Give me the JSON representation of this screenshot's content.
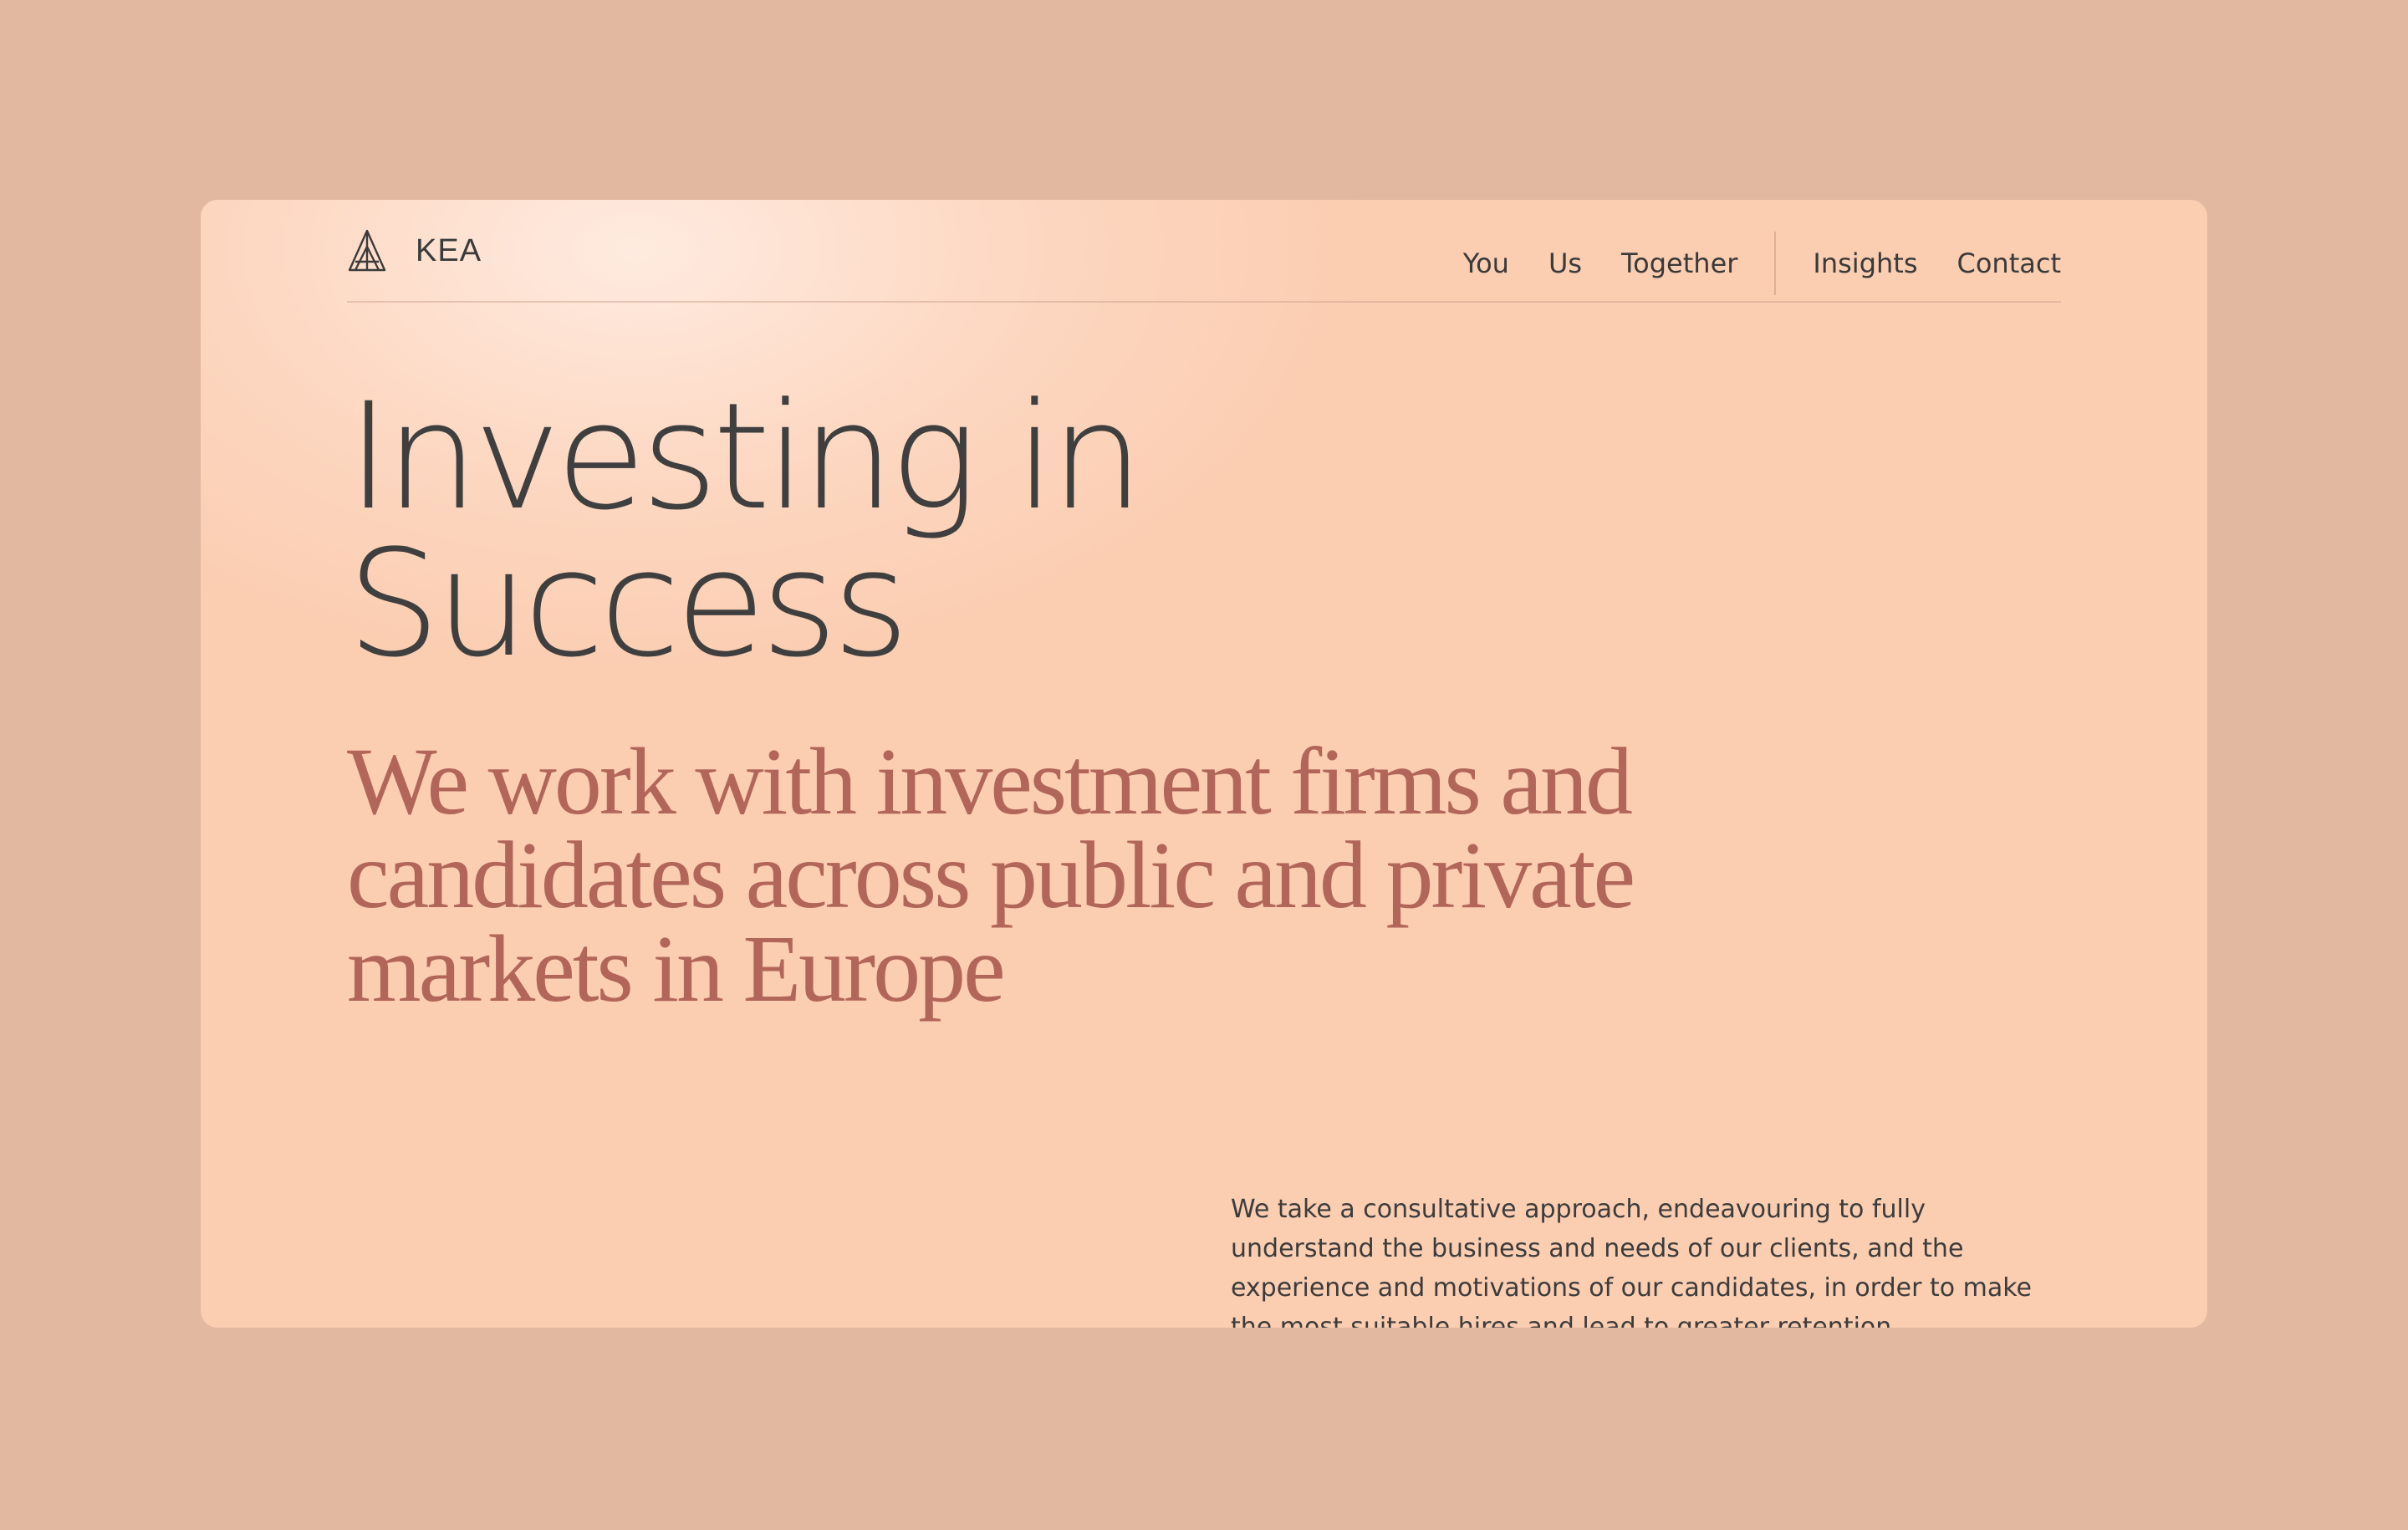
{
  "brand": {
    "name": "KEA",
    "logo_icon": "kea-triangle-logo-icon"
  },
  "nav": {
    "items": [
      {
        "label": "You"
      },
      {
        "label": "Us"
      },
      {
        "label": "Together"
      },
      {
        "label": "Insights"
      },
      {
        "label": "Contact"
      }
    ]
  },
  "hero": {
    "title_line1": "Investing in",
    "title_line2": "Success",
    "subtitle": "We work with investment firms and candidates across public and private markets in Europe",
    "body": "We take a consultative approach, endeavouring to fully understand the business and needs of our clients, and the experience and motivations of our candidates, in order to make the most suitable hires and lead to greater retention."
  },
  "colors": {
    "page_background": "#e2b8a0",
    "card_background": "#fbcdb1",
    "title_text": "#3f3f3f",
    "accent_text": "#b2665a"
  }
}
